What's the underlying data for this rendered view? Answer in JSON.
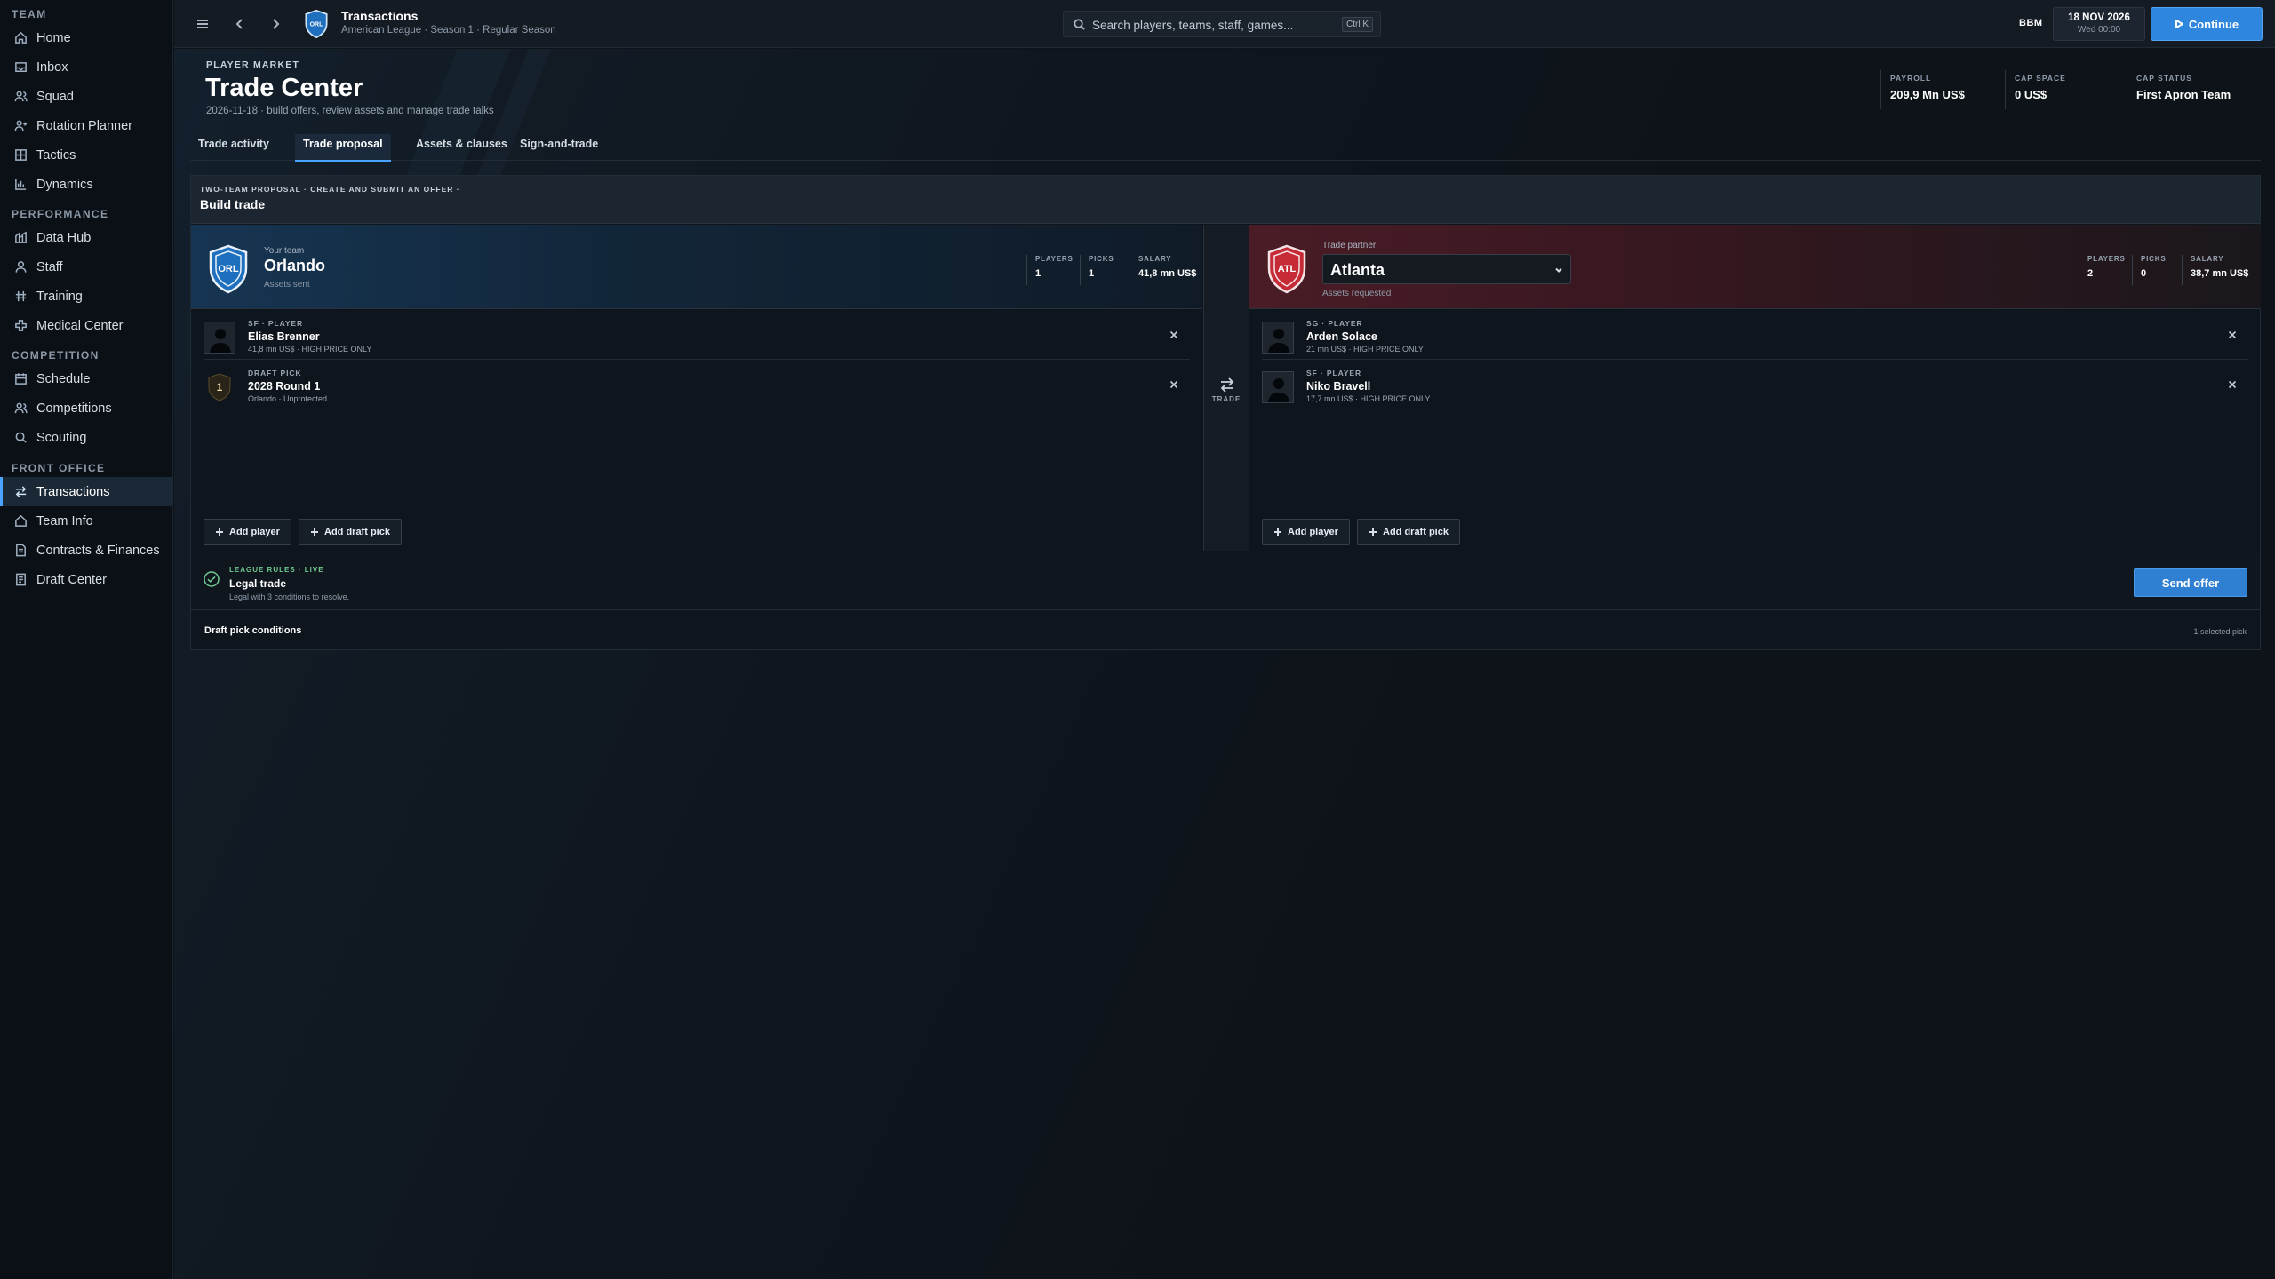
{
  "sidebar": {
    "sections": [
      {
        "title": "TEAM",
        "items": [
          {
            "label": "Home",
            "icon": "home-icon"
          },
          {
            "label": "Inbox",
            "icon": "inbox-icon"
          },
          {
            "label": "Squad",
            "icon": "users-icon"
          },
          {
            "label": "Rotation Planner",
            "icon": "rotation-icon"
          },
          {
            "label": "Tactics",
            "icon": "tactics-icon"
          },
          {
            "label": "Dynamics",
            "icon": "chart-icon"
          }
        ]
      },
      {
        "title": "PERFORMANCE",
        "items": [
          {
            "label": "Data Hub",
            "icon": "data-hub-icon"
          },
          {
            "label": "Staff",
            "icon": "staff-icon"
          },
          {
            "label": "Training",
            "icon": "training-icon"
          },
          {
            "label": "Medical Center",
            "icon": "medical-icon"
          }
        ]
      },
      {
        "title": "COMPETITION",
        "items": [
          {
            "label": "Schedule",
            "icon": "calendar-icon"
          },
          {
            "label": "Competitions",
            "icon": "competitions-icon"
          },
          {
            "label": "Scouting",
            "icon": "scouting-icon"
          }
        ]
      },
      {
        "title": "FRONT OFFICE",
        "items": [
          {
            "label": "Transactions",
            "icon": "transactions-icon",
            "active": true
          },
          {
            "label": "Team Info",
            "icon": "team-info-icon"
          },
          {
            "label": "Contracts & Finances",
            "icon": "contracts-icon"
          },
          {
            "label": "Draft Center",
            "icon": "draft-icon"
          }
        ]
      }
    ]
  },
  "topbar": {
    "title": "Transactions",
    "subtitle": "American League · Season 1 · Regular Season",
    "crest_text": "ORL",
    "search_placeholder": "Search players, teams, staff, games...",
    "search_shortcut": "Ctrl K",
    "user": "BBM",
    "date": "18 NOV 2026",
    "date_sub": "Wed 00:00",
    "continue_label": "Continue"
  },
  "header": {
    "eyebrow": "PLAYER MARKET",
    "title": "Trade Center",
    "subtitle": "2026-11-18 · build offers, review assets and manage trade talks",
    "kpis": [
      {
        "label": "PAYROLL",
        "value": "209,9 Mn US$"
      },
      {
        "label": "CAP SPACE",
        "value": "0 US$"
      },
      {
        "label": "CAP STATUS",
        "value": "First Apron Team"
      }
    ]
  },
  "tabs": [
    {
      "label": "Trade activity"
    },
    {
      "label": "Trade proposal",
      "active": true
    },
    {
      "label": "Assets & clauses"
    },
    {
      "label": "Sign-and-trade"
    }
  ],
  "build": {
    "eyebrow": "TWO-TEAM PROPOSAL · CREATE AND SUBMIT AN OFFER ·",
    "title": "Build trade",
    "trade_label": "TRADE",
    "left": {
      "kicker": "Your team",
      "team": "Orlando",
      "crest_text": "ORL",
      "note": "Assets sent",
      "stats": [
        {
          "label": "PLAYERS",
          "value": "1"
        },
        {
          "label": "PICKS",
          "value": "1"
        },
        {
          "label": "SALARY",
          "value": "41,8 mn US$"
        }
      ],
      "assets": [
        {
          "pos": "SF · PLAYER",
          "name": "Elias Brenner",
          "meta": "41,8 mn US$ · HIGH PRICE ONLY"
        },
        {
          "pos": "DRAFT PICK",
          "name": "2028 Round 1",
          "meta": "Orlando · Unprotected",
          "pick_round": "1"
        }
      ],
      "add_player": "Add player",
      "add_pick": "Add draft pick"
    },
    "right": {
      "kicker": "Trade partner",
      "team": "Atlanta",
      "crest_text": "ATL",
      "note": "Assets requested",
      "stats": [
        {
          "label": "PLAYERS",
          "value": "2"
        },
        {
          "label": "PICKS",
          "value": "0"
        },
        {
          "label": "SALARY",
          "value": "38,7 mn US$"
        }
      ],
      "assets": [
        {
          "pos": "SG · PLAYER",
          "name": "Arden Solace",
          "meta": "21 mn US$ · HIGH PRICE ONLY"
        },
        {
          "pos": "SF · PLAYER",
          "name": "Niko Bravell",
          "meta": "17,7 mn US$ · HIGH PRICE ONLY"
        }
      ],
      "add_player": "Add player",
      "add_pick": "Add draft pick"
    },
    "rules": {
      "eyebrow": "LEAGUE RULES · LIVE",
      "title": "Legal trade",
      "desc": "Legal with 3 conditions to resolve.",
      "send_label": "Send offer"
    },
    "conditions": {
      "label": "Draft pick conditions",
      "count": "1 selected pick"
    }
  },
  "colors": {
    "accent": "#2f86de",
    "your_team": "#1f6fbf",
    "partner_team": "#c62a36",
    "legal": "#6fc98f"
  }
}
